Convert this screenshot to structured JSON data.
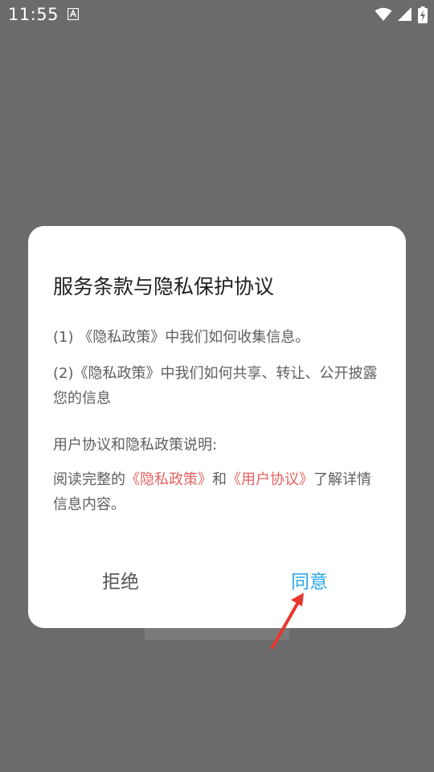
{
  "status_bar": {
    "time": "11:55",
    "icons": [
      "a-notification-icon",
      "wifi-icon",
      "signal-icon",
      "battery-charging-icon"
    ]
  },
  "dialog": {
    "title": "服务条款与隐私保护协议",
    "item1": "(1) 《隐私政策》中我们如何收集信息。",
    "item2": "(2)《隐私政策》中我们如何共享、转让、公开披露您的信息",
    "section_heading": "用户协议和隐私政策说明:",
    "read_prefix": "阅读完整的",
    "privacy_link": "《隐私政策》",
    "and_text": "和",
    "user_agreement_link": "《用户协议》",
    "read_suffix": "了解详情信息内容。",
    "reject_label": "拒绝",
    "agree_label": "同意"
  },
  "colors": {
    "overlay": "#6b6b6b",
    "link": "#e36262",
    "agree": "#27a8e6",
    "annotation_arrow": "#e8372e"
  }
}
